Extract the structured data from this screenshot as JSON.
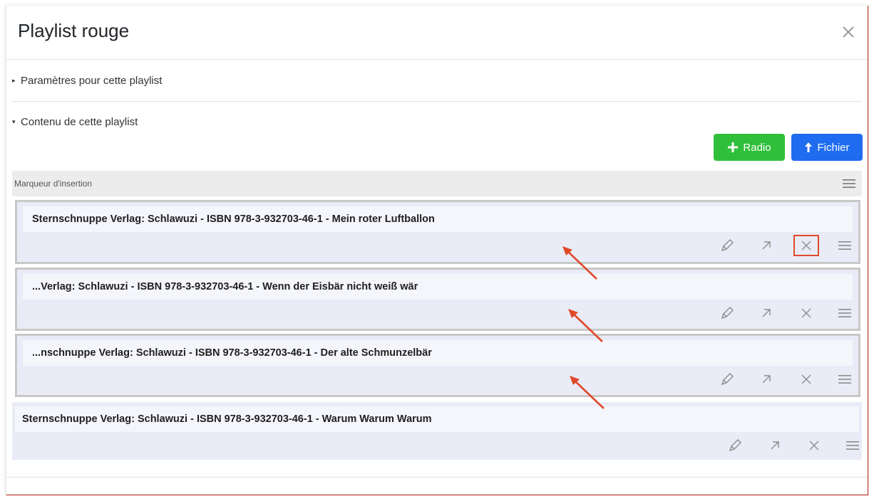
{
  "modal": {
    "title": "Playlist rouge",
    "close_icon": "close-icon"
  },
  "sections": {
    "settings_label": "Paramètres pour cette playlist",
    "settings_expanded": false,
    "content_label": "Contenu de cette playlist",
    "content_expanded": true
  },
  "buttons": {
    "radio_label": "Radio",
    "radio_icon": "plus-icon",
    "file_label": "Fichier",
    "file_icon": "arrow-up-icon",
    "radio_color": "#2fbf3a",
    "file_color": "#1f6cf0"
  },
  "marker": {
    "label": "Marqueur d'insertion"
  },
  "items": [
    {
      "title": "Sternschnuppe Verlag: Schlawuzi - ISBN 978-3-932703-46-1 - Mein roter Luftballon"
    },
    {
      "title": "...Verlag: Schlawuzi - ISBN 978-3-932703-46-1 - Wenn der Eisbär nicht weiß wär"
    },
    {
      "title": "...nschnuppe Verlag: Schlawuzi - ISBN 978-3-932703-46-1 - Der alte Schmunzelbär"
    },
    {
      "title": "Sternschnuppe Verlag: Schlawuzi - ISBN 978-3-932703-46-1 - Warum Warum Warum"
    }
  ],
  "item_actions": [
    "pencil-icon",
    "external-link-icon",
    "delete-icon",
    "drag-handle-icon"
  ],
  "annotation_color": "#e0492a"
}
